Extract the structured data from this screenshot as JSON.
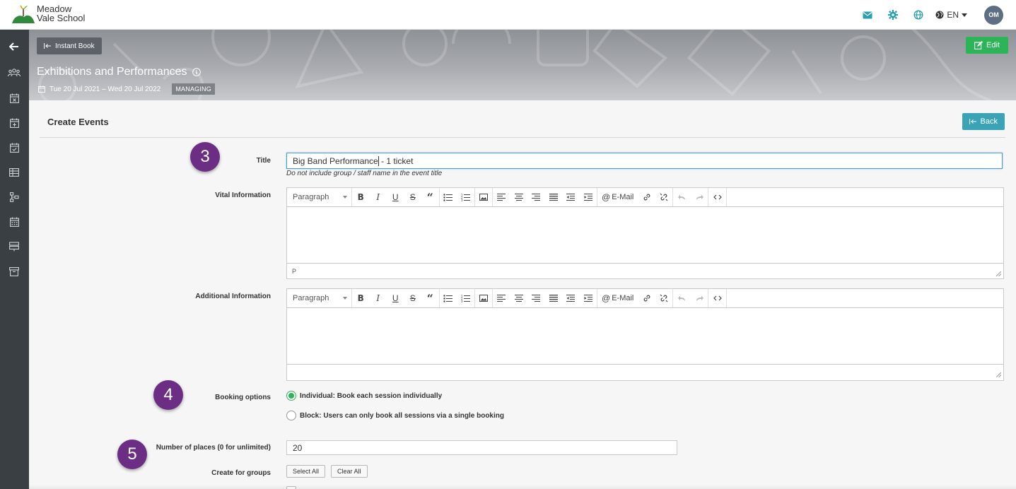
{
  "app": {
    "logo_line1": "Meadow",
    "logo_line2": "Vale School"
  },
  "topbar": {
    "language": "EN",
    "avatar_initials": "OM",
    "icons": [
      "mail-icon",
      "gear-icon",
      "globe-icon",
      "language-globe-icon"
    ]
  },
  "sidebar": {
    "items": [
      "back-arrow-icon",
      "groups-icon",
      "calendar-x-icon",
      "calendar-plus-icon",
      "calendar-check-icon",
      "table-icon",
      "flow-icon",
      "calendar-grid-icon",
      "layers-icon",
      "archive-icon"
    ]
  },
  "banner": {
    "instant_book_label": "Instant Book",
    "edit_label": "Edit",
    "title": "Exhibitions and Performances",
    "dates": "Tue 20 Jul 2021 – Wed 20 Jul 2022",
    "status_badge": "MANAGING"
  },
  "section": {
    "title": "Create Events",
    "back_label": "Back"
  },
  "form": {
    "title_label": "Title",
    "title_value_before_cursor": "Big Band Performance",
    "title_value_after_cursor": " - 1 ticket",
    "title_hint": "Do not include group / staff name in the event title",
    "vital_label": "Vital Information",
    "additional_label": "Additional Information",
    "editor_paragraph": "Paragraph",
    "editor_email": "E-Mail",
    "editor_status": "P",
    "booking_label": "Booking options",
    "booking_option_individual": "Individual: Book each session individually",
    "booking_option_block": "Block: Users can only book all sessions via a single booking",
    "booking_selected": "individual",
    "places_label": "Number of places (0 for unlimited)",
    "places_value": "20",
    "groups_label": "Create for groups",
    "select_all_label": "Select All",
    "clear_all_label": "Clear All"
  },
  "steps": {
    "step_title": "3",
    "step_booking": "4",
    "step_places": "5"
  },
  "colors": {
    "sidebar": "#3a3f44",
    "accent_teal": "#3aa3b5",
    "edit_green": "#2db458",
    "step_purple": "#6c2e84",
    "icon_teal": "#2a9fae"
  }
}
